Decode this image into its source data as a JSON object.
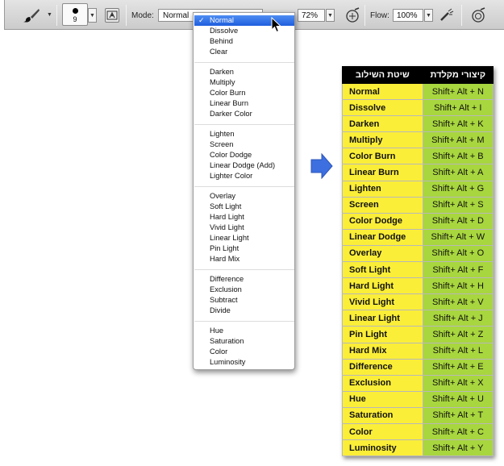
{
  "toolbar": {
    "brush_size": "9",
    "mode_label": "Mode:",
    "mode_value": "Normal",
    "opacity_value": "72%",
    "flow_label": "Flow:",
    "flow_value": "100%"
  },
  "menu": {
    "selected": "Normal",
    "groups": [
      [
        "Normal",
        "Dissolve",
        "Behind",
        "Clear"
      ],
      [
        "Darken",
        "Multiply",
        "Color Burn",
        "Linear Burn",
        "Darker Color"
      ],
      [
        "Lighten",
        "Screen",
        "Color Dodge",
        "Linear Dodge (Add)",
        "Lighter Color"
      ],
      [
        "Overlay",
        "Soft Light",
        "Hard Light",
        "Vivid Light",
        "Linear Light",
        "Pin Light",
        "Hard Mix"
      ],
      [
        "Difference",
        "Exclusion",
        "Subtract",
        "Divide"
      ],
      [
        "Hue",
        "Saturation",
        "Color",
        "Luminosity"
      ]
    ]
  },
  "table": {
    "header_mode": "שיטת השילוב",
    "header_shortcut": "קיצורי מקלדת",
    "rows": [
      {
        "mode": "Normal",
        "shortcut": "Shift+ Alt +  N"
      },
      {
        "mode": "Dissolve",
        "shortcut": "Shift+ Alt + I"
      },
      {
        "mode": "Darken",
        "shortcut": "Shift+ Alt + K"
      },
      {
        "mode": "Multiply",
        "shortcut": "Shift+ Alt + M"
      },
      {
        "mode": "Color Burn",
        "shortcut": "Shift+ Alt + B"
      },
      {
        "mode": "Linear Burn",
        "shortcut": "Shift+ Alt + A"
      },
      {
        "mode": "Lighten",
        "shortcut": "Shift+ Alt + G"
      },
      {
        "mode": "Screen",
        "shortcut": "Shift+ Alt + S"
      },
      {
        "mode": "Color Dodge",
        "shortcut": "Shift+ Alt + D"
      },
      {
        "mode": "Linear Dodge",
        "shortcut": "Shift+ Alt + W"
      },
      {
        "mode": "Overlay",
        "shortcut": "Shift+ Alt + O"
      },
      {
        "mode": "Soft Light",
        "shortcut": "Shift+ Alt + F"
      },
      {
        "mode": "Hard Light",
        "shortcut": "Shift+ Alt + H"
      },
      {
        "mode": "Vivid Light",
        "shortcut": "Shift+ Alt + V"
      },
      {
        "mode": "Linear Light",
        "shortcut": "Shift+ Alt + J"
      },
      {
        "mode": "Pin Light",
        "shortcut": "Shift+ Alt + Z"
      },
      {
        "mode": "Hard Mix",
        "shortcut": "Shift+ Alt + L"
      },
      {
        "mode": "Difference",
        "shortcut": "Shift+ Alt + E"
      },
      {
        "mode": "Exclusion",
        "shortcut": "Shift+ Alt + X"
      },
      {
        "mode": "Hue",
        "shortcut": "Shift+ Alt + U"
      },
      {
        "mode": "Saturation",
        "shortcut": "Shift+ Alt + T"
      },
      {
        "mode": "Color",
        "shortcut": "Shift+ Alt + C"
      },
      {
        "mode": "Luminosity",
        "shortcut": "Shift+ Alt + Y"
      }
    ]
  },
  "colors": {
    "mode_cell": "#fbee38",
    "shortcut_cell": "#a8d63e",
    "header": "#000000",
    "selection": "#2a6ae6",
    "arrow": "#3d6fe0"
  },
  "icons": {
    "brush": "brush-icon",
    "brush_panel": "brush-panel-icon",
    "opacity_pressure": "pressure-opacity-icon",
    "airbrush": "airbrush-icon",
    "flow_pressure": "pressure-size-icon",
    "cursor": "mouse-cursor-icon",
    "arrow": "right-arrow-icon"
  }
}
